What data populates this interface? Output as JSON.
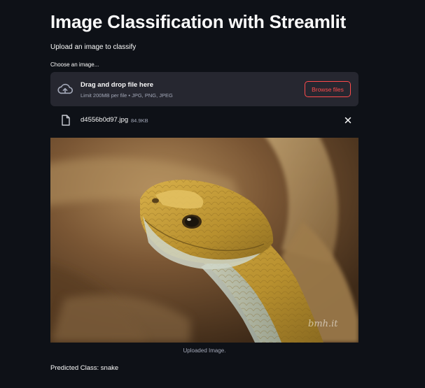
{
  "app": {
    "title": "Image Classification with Streamlit",
    "subtitle": "Upload an image to classify"
  },
  "uploader": {
    "label": "Choose an image...",
    "drop_text": "Drag and drop file here",
    "limit_text": "Limit 200MB per file • JPG, PNG, JPEG",
    "browse_label": "Browse files",
    "upload_icon": "cloud-upload-icon"
  },
  "uploaded_file": {
    "name": "d4556b0d97.jpg",
    "size": "84.9KB",
    "file_icon": "file-icon",
    "remove_icon": "close-icon"
  },
  "image": {
    "caption": "Uploaded Image.",
    "watermark": "bmh.it"
  },
  "result": {
    "prediction": "Predicted Class: snake"
  },
  "colors": {
    "background": "#0e1117",
    "secondary_background": "#262730",
    "primary": "#ff4b4b",
    "text": "#fafafa",
    "muted_text": "#a3a8b8"
  }
}
